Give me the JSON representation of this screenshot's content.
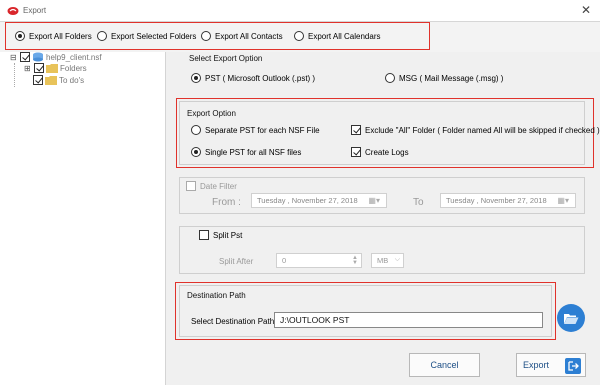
{
  "window": {
    "title": "Export",
    "close_glyph": "✕"
  },
  "export_scope": {
    "options": [
      {
        "label": "Export All Folders",
        "selected": true
      },
      {
        "label": "Export Selected Folders",
        "selected": false
      },
      {
        "label": "Export All Contacts",
        "selected": false
      },
      {
        "label": "Export All Calendars",
        "selected": false
      }
    ]
  },
  "tree": {
    "root": {
      "label": "help9_client.nsf",
      "checked": true
    },
    "children": [
      {
        "label": "Folders",
        "checked": true
      },
      {
        "label": "To do's",
        "checked": true
      }
    ]
  },
  "select_export_option": {
    "title": "Select Export Option",
    "pst_label": "PST ( Microsoft Outlook (.pst) )",
    "msg_label": "MSG ( Mail Message (.msg) )",
    "selected": "pst"
  },
  "export_option": {
    "title": "Export Option",
    "separate_label": "Separate PST for each NSF File",
    "single_label": "Single PST for all NSF files",
    "exclude_label": "Exclude \"All\" Folder ( Folder named All will be skipped if checked )",
    "create_logs_label": "Create Logs",
    "selected": "single",
    "exclude_checked": true,
    "create_logs_checked": true
  },
  "date_filter": {
    "label": "Date Filter",
    "from_label": "From :",
    "to_label": "To",
    "from_value": "Tuesday  ,  November 27, 2018",
    "to_value": "Tuesday  ,  November 27, 2018"
  },
  "split_pst": {
    "label": "Split Pst",
    "split_after_label": "Split After",
    "size_value": "0",
    "unit_value": "MB"
  },
  "destination": {
    "title": "Destination Path",
    "select_label": "Select Destination Path",
    "path_value": "J:\\OUTLOOK PST"
  },
  "buttons": {
    "cancel": "Cancel",
    "export": "Export"
  },
  "colors": {
    "highlight_red": "#e0322b",
    "button_text": "#1d4f86",
    "folder_blue": "#2d7fd3"
  },
  "icons": {
    "app": "app-logo-icon",
    "browse": "folder-open-icon",
    "export": "export-arrow-icon"
  }
}
